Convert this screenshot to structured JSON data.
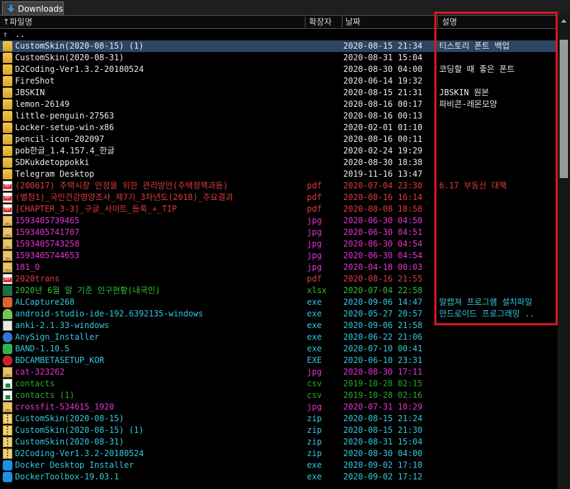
{
  "tab": {
    "label": "Downloads",
    "icon": "download-arrow-icon"
  },
  "header": {
    "name": "파일명",
    "ext": "확장자",
    "date": "날짜",
    "desc": "설명"
  },
  "colors": {
    "folder": "#eaeaea",
    "pdf": "#e03b3b",
    "jpg": "#e535d2",
    "xlsx": "#34c034",
    "exe": "#33c9de",
    "csv": "#2aa82a",
    "zip": "#33c9de",
    "highlight": "#e0161d",
    "selection": "#2c4663"
  },
  "rows": [
    {
      "name": "..",
      "ext": "",
      "date": "",
      "desc": "",
      "type": "up"
    },
    {
      "name": "CustomSkin(2020-08-15) (1)",
      "ext": "",
      "date": "2020-08-15 21:34",
      "desc": "티스토리 폰트 백업",
      "type": "folder",
      "selected": true
    },
    {
      "name": "CustomSkin(2020-08-31)",
      "ext": "",
      "date": "2020-08-31 15:04",
      "desc": "",
      "type": "folder"
    },
    {
      "name": "D2Coding-Ver1.3.2-20180524",
      "ext": "",
      "date": "2020-08-30 04:00",
      "desc": "코딩할 때 좋은 폰트",
      "type": "folder"
    },
    {
      "name": "FireShot",
      "ext": "",
      "date": "2020-06-14 19:32",
      "desc": "",
      "type": "folder"
    },
    {
      "name": "JBSKIN",
      "ext": "",
      "date": "2020-08-15 21:31",
      "desc": "JBSKIN 원본",
      "type": "folder"
    },
    {
      "name": "lemon-26149",
      "ext": "",
      "date": "2020-08-16 00:17",
      "desc": "파비콘-레몬모양",
      "type": "folder"
    },
    {
      "name": "little-penguin-27563",
      "ext": "",
      "date": "2020-08-16 00:13",
      "desc": "",
      "type": "folder"
    },
    {
      "name": "Locker-setup-win-x86",
      "ext": "",
      "date": "2020-02-01 01:10",
      "desc": "",
      "type": "folder"
    },
    {
      "name": "pencil-icon-202097",
      "ext": "",
      "date": "2020-08-16 00:11",
      "desc": "",
      "type": "folder"
    },
    {
      "name": "pob한글_1.4.157.4_한글",
      "ext": "",
      "date": "2020-02-24 19:29",
      "desc": "",
      "type": "folder"
    },
    {
      "name": "SDKukdetoppokki",
      "ext": "",
      "date": "2020-08-30 18:38",
      "desc": "",
      "type": "folder"
    },
    {
      "name": "Telegram Desktop",
      "ext": "",
      "date": "2019-11-16 13:47",
      "desc": "",
      "type": "folder"
    },
    {
      "name": "(200617) 주택시장 안정을 위한 관리방안(주택정책과등)",
      "ext": "pdf",
      "date": "2020-07-04 23:30",
      "desc": "6.17 부동산 대책",
      "type": "pdf"
    },
    {
      "name": "(별첨1)_국민건강영양조사_제7기_3차년도(2018)_주요결과",
      "ext": "pdf",
      "date": "2020-08-16 16:14",
      "desc": "",
      "type": "pdf"
    },
    {
      "name": "[CHAPTER_3-3]_구글_사이트_등록_+_TIP",
      "ext": "pdf",
      "date": "2020-08-08 18:58",
      "desc": "",
      "type": "pdf"
    },
    {
      "name": "1593405739465",
      "ext": "jpg",
      "date": "2020-06-30 04:50",
      "desc": "",
      "type": "jpg"
    },
    {
      "name": "1593405741707",
      "ext": "jpg",
      "date": "2020-06-30 04:51",
      "desc": "",
      "type": "jpg"
    },
    {
      "name": "1593405743258",
      "ext": "jpg",
      "date": "2020-06-30 04:54",
      "desc": "",
      "type": "jpg"
    },
    {
      "name": "1593405744653",
      "ext": "jpg",
      "date": "2020-06-30 04:54",
      "desc": "",
      "type": "jpg"
    },
    {
      "name": "181_0",
      "ext": "jpg",
      "date": "2020-04-18 00:03",
      "desc": "",
      "type": "jpg"
    },
    {
      "name": "2020trans",
      "ext": "pdf",
      "date": "2020-08-16 21:55",
      "desc": "",
      "type": "pdf"
    },
    {
      "name": "2020년 6월 말 기준 인구현황(내국인)",
      "ext": "xlsx",
      "date": "2020-07-04 22:58",
      "desc": "",
      "type": "xlsx"
    },
    {
      "name": "ALCapture268",
      "ext": "exe",
      "date": "2020-09-06 14:47",
      "desc": "알캡쳐 프로그램 설치파일",
      "type": "exe",
      "icon": "orange"
    },
    {
      "name": "android-studio-ide-192.6392135-windows",
      "ext": "exe",
      "date": "2020-05-27 20:57",
      "desc": "안드로이드 프로그래밍 ..",
      "type": "exe",
      "icon": "android"
    },
    {
      "name": "anki-2.1.33-windows",
      "ext": "exe",
      "date": "2020-09-06 21:58",
      "desc": "",
      "type": "exe"
    },
    {
      "name": "AnySign_Installer",
      "ext": "exe",
      "date": "2020-06-22 21:06",
      "desc": "",
      "type": "exe",
      "icon": "blue"
    },
    {
      "name": "BAND-1.10.5",
      "ext": "exe",
      "date": "2020-07-10 00:41",
      "desc": "",
      "type": "exe",
      "icon": "green"
    },
    {
      "name": "BDCAMBETASETUP_KOR",
      "ext": "EXE",
      "date": "2020-06-10 23:31",
      "desc": "",
      "type": "exe",
      "icon": "red"
    },
    {
      "name": "cat-323262",
      "ext": "jpg",
      "date": "2020-08-30 17:11",
      "desc": "",
      "type": "jpg"
    },
    {
      "name": "contacts",
      "ext": "csv",
      "date": "2019-10-28 02:15",
      "desc": "",
      "type": "csv"
    },
    {
      "name": "contacts (1)",
      "ext": "csv",
      "date": "2019-10-28 02:16",
      "desc": "",
      "type": "csv"
    },
    {
      "name": "crossfit-534615_1920",
      "ext": "jpg",
      "date": "2020-07-31 10:29",
      "desc": "",
      "type": "jpg"
    },
    {
      "name": "CustomSkin(2020-08-15)",
      "ext": "zip",
      "date": "2020-08-15 21:24",
      "desc": "",
      "type": "zip"
    },
    {
      "name": "CustomSkin(2020-08-15) (1)",
      "ext": "zip",
      "date": "2020-08-15 21:30",
      "desc": "",
      "type": "zip"
    },
    {
      "name": "CustomSkin(2020-08-31)",
      "ext": "zip",
      "date": "2020-08-31 15:04",
      "desc": "",
      "type": "zip"
    },
    {
      "name": "D2Coding-Ver1.3.2-20180524",
      "ext": "zip",
      "date": "2020-08-30 04:00",
      "desc": "",
      "type": "zip"
    },
    {
      "name": "Docker Desktop Installer",
      "ext": "exe",
      "date": "2020-09-02 17:10",
      "desc": "",
      "type": "exe",
      "icon": "docker"
    },
    {
      "name": "DockerToolbox-19.03.1",
      "ext": "exe",
      "date": "2020-09-02 17:12",
      "desc": "",
      "type": "exe",
      "icon": "docker"
    }
  ]
}
